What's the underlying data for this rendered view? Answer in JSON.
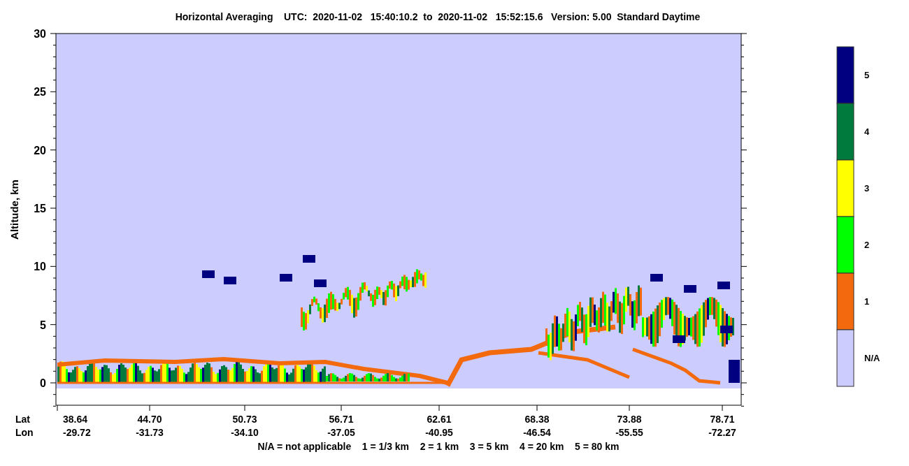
{
  "title": "Horizontal Averaging    UTC:  2020-11-02   15:40:10.2  to  2020-11-02   15:52:15.6   Version: 5.00  Standard Daytime",
  "y_axis": {
    "label": "Altitude, km",
    "ticks": [
      "30",
      "25",
      "20",
      "15",
      "10",
      "5",
      "0"
    ]
  },
  "x_axis": {
    "row_labels": [
      "Lat",
      "Lon"
    ],
    "ticks": [
      {
        "lat": "38.64",
        "lon": "-29.72"
      },
      {
        "lat": "44.70",
        "lon": "-31.73"
      },
      {
        "lat": "50.73",
        "lon": "-34.10"
      },
      {
        "lat": "56.71",
        "lon": "-37.05"
      },
      {
        "lat": "62.61",
        "lon": "-40.95"
      },
      {
        "lat": "68.38",
        "lon": "-46.54"
      },
      {
        "lat": "73.88",
        "lon": "-55.55"
      },
      {
        "lat": "78.71",
        "lon": "-72.27"
      }
    ]
  },
  "legend": [
    {
      "label": "5",
      "color": "#000080"
    },
    {
      "label": "4",
      "color": "#007a3d"
    },
    {
      "label": "3",
      "color": "#ffff00"
    },
    {
      "label": "2",
      "color": "#00ff00"
    },
    {
      "label": "1",
      "color": "#f26a0d"
    },
    {
      "label": "N/A",
      "color": "#ccccff"
    }
  ],
  "footnote": "N/A = not applicable    1 = 1/3 km    2 = 1 km    3 = 5 km    4 = 20 km    5 = 80 km"
}
